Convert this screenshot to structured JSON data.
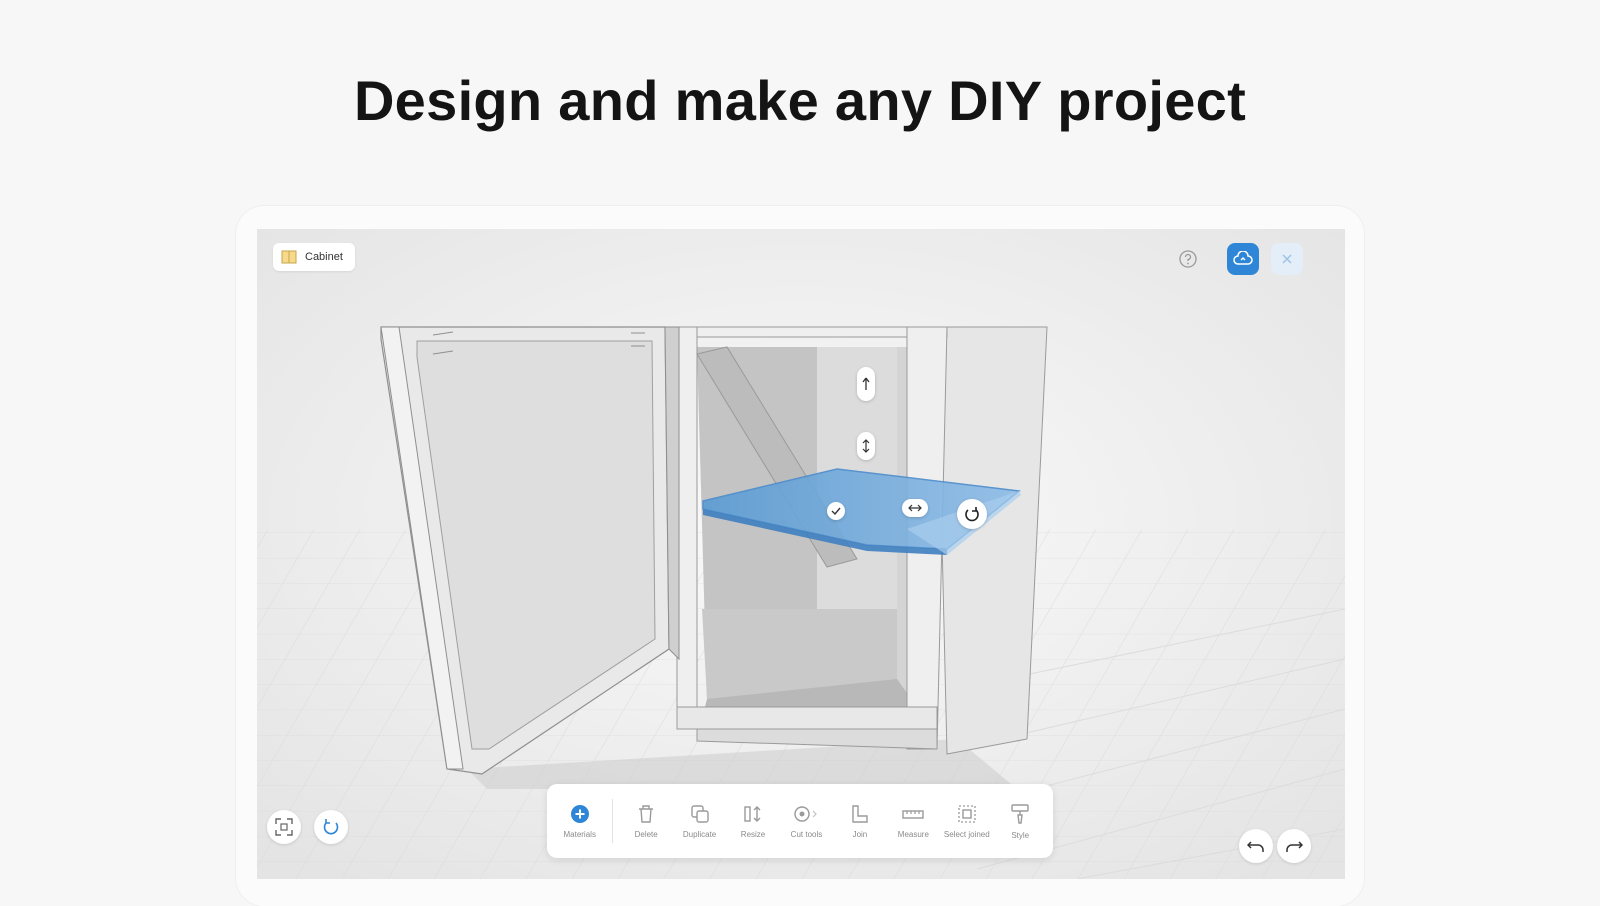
{
  "headline": "Design and make any DIY project",
  "app": {
    "project_name": "Cabinet",
    "accent_color": "#2f86d6",
    "icons": {
      "project": "cabinet-icon",
      "help": "help-icon",
      "cloud": "cloud-sync-icon",
      "close": "close-icon",
      "fit_view": "fit-view-icon",
      "rotate_view": "rotate-view-icon",
      "undo": "undo-icon",
      "redo": "redo-icon"
    },
    "toolbar": [
      {
        "label": "Materials",
        "icon": "plus-circle-icon",
        "active": true
      },
      {
        "label": "Delete",
        "icon": "trash-icon",
        "active": false
      },
      {
        "label": "Duplicate",
        "icon": "duplicate-icon",
        "active": false
      },
      {
        "label": "Resize",
        "icon": "resize-icon",
        "active": false
      },
      {
        "label": "Cut tools",
        "icon": "saw-icon",
        "active": false
      },
      {
        "label": "Join",
        "icon": "join-icon",
        "active": false
      },
      {
        "label": "Measure",
        "icon": "ruler-icon",
        "active": false
      },
      {
        "label": "Select joined",
        "icon": "select-joined-icon",
        "active": false
      },
      {
        "label": "Style",
        "icon": "paint-brush-icon",
        "active": false
      }
    ]
  }
}
